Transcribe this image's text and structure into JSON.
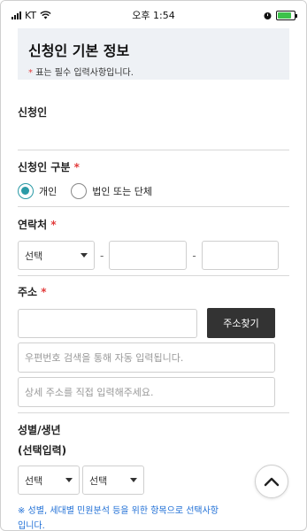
{
  "status_bar": {
    "carrier": "KT",
    "time": "오후 1:54"
  },
  "header": {
    "title": "신청인 기본 정보",
    "required_star": "*",
    "required_note": "표는 필수 입력사항입니다."
  },
  "applicant": {
    "label": "신청인"
  },
  "applicant_type": {
    "label": "신청인 구분",
    "required_star": "*",
    "options": [
      "개인",
      "법인 또는 단체"
    ],
    "selected": "개인"
  },
  "contact": {
    "label": "연락처",
    "required_star": "*",
    "select_value": "선택",
    "separator": "-"
  },
  "address": {
    "label": "주소",
    "required_star": "*",
    "search_button": "주소찾기",
    "auto_placeholder": "우편번호 검색을 통해 자동 입력됩니다.",
    "detail_placeholder": "상세 주소를 직접 입력해주세요."
  },
  "gender_birth": {
    "label": "성별/생년",
    "sub_label": "(선택입력)",
    "select1_value": "선택",
    "select2_value": "선택",
    "note": "※ 성별, 세대별 민원분석 등을 위한 항목으로 선택사항",
    "note_cont": "입니다."
  },
  "colors": {
    "accent": "#2a9aa6",
    "required": "#e23c3c",
    "note": "#1f6fd6",
    "dark_button": "#333333",
    "header_bg": "#eef1f5"
  }
}
